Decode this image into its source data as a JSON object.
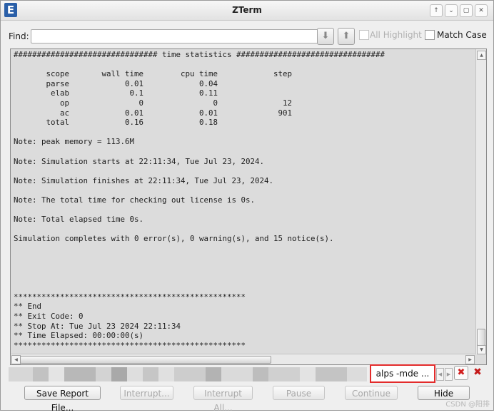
{
  "window": {
    "title": "ZTerm",
    "app_icon_letter": "E",
    "controls": [
      "↑",
      "⌄",
      "▢",
      "✕"
    ]
  },
  "find": {
    "label": "Find:",
    "value": "",
    "all_highlight_label": "All Highlight",
    "match_case_label": "Match Case"
  },
  "terminal": {
    "lines": [
      "############################### time statistics ################################",
      "",
      "       scope       wall time        cpu time            step",
      "       parse            0.01            0.04",
      "        elab             0.1            0.11",
      "          op               0               0              12",
      "          ac            0.01            0.01             901",
      "       total            0.16            0.18",
      "",
      "Note: peak memory = 113.6M",
      "",
      "Note: Simulation starts at 22:11:34, Tue Jul 23, 2024.",
      "",
      "Note: Simulation finishes at 22:11:34, Tue Jul 23, 2024.",
      "",
      "Note: The total time for checking out license is 0s.",
      "",
      "Note: Total elapsed time 0s.",
      "",
      "Simulation completes with 0 error(s), 0 warning(s), and 15 notice(s).",
      "",
      "",
      "",
      "",
      "",
      "**************************************************",
      "** End",
      "** Exit Code: 0",
      "** Stop At: Tue Jul 23 2024 22:11:34",
      "** Time Elapsed: 00:00:00(s)",
      "**************************************************"
    ]
  },
  "process_tab": {
    "label": "alps -mde ..."
  },
  "buttons": {
    "save_report": "Save Report File...",
    "interrupt": "Interrupt...",
    "interrupt_all": "Interrupt All...",
    "pause": "Pause",
    "continue": "Continue",
    "hide": "Hide"
  },
  "watermark": "CSDN @阳排",
  "colors": {
    "terminal_bg": "#dcdcdc",
    "tab_highlight": "#e32b2b",
    "close_red": "#d21f1f"
  }
}
